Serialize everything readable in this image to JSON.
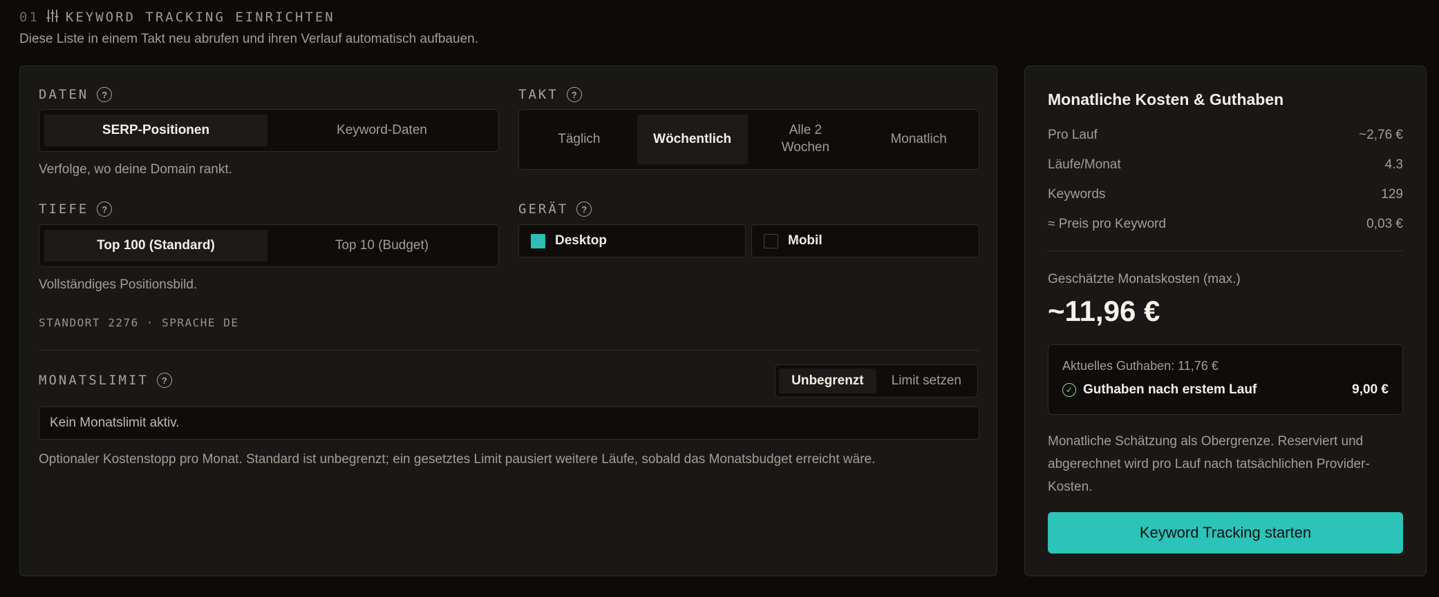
{
  "header": {
    "number": "01",
    "icon": "sliders-icon",
    "title": "KEYWORD TRACKING EINRICHTEN",
    "subtitle": "Diese Liste in einem Takt neu abrufen und ihren Verlauf automatisch aufbauen."
  },
  "daten": {
    "label": "DATEN",
    "options": [
      "SERP-Positionen",
      "Keyword-Daten"
    ],
    "selected": "SERP-Positionen",
    "help": "Verfolge, wo deine Domain rankt."
  },
  "takt": {
    "label": "TAKT",
    "options": [
      "Täglich",
      "Wöchentlich",
      "Alle 2\nWochen",
      "Monatlich"
    ],
    "selected": "Wöchentlich"
  },
  "tiefe": {
    "label": "TIEFE",
    "options": [
      "Top 100 (Standard)",
      "Top 10 (Budget)"
    ],
    "selected": "Top 100 (Standard)",
    "help": "Vollständiges Positionsbild."
  },
  "geraet": {
    "label": "GERÄT",
    "options": [
      {
        "label": "Desktop",
        "checked": true
      },
      {
        "label": "Mobil",
        "checked": false
      }
    ]
  },
  "location": "STANDORT 2276 · SPRACHE DE",
  "monatslimit": {
    "label": "MONATSLIMIT",
    "options": [
      "Unbegrenzt",
      "Limit setzen"
    ],
    "selected": "Unbegrenzt",
    "value": "Kein Monatslimit aktiv.",
    "help": "Optionaler Kostenstopp pro Monat. Standard ist unbegrenzt; ein gesetztes Limit pausiert weitere Läufe, sobald das Monatsbudget erreicht wäre."
  },
  "costs": {
    "title": "Monatliche Kosten & Guthaben",
    "rows": [
      {
        "label": "Pro Lauf",
        "value": "~2,76 €"
      },
      {
        "label": "Läufe/Monat",
        "value": "4.3"
      },
      {
        "label": "Keywords",
        "value": "129"
      },
      {
        "label": "≈ Preis pro Keyword",
        "value": "0,03 €"
      }
    ],
    "estimate_label": "Geschätzte Monatskosten (max.)",
    "estimate_value": "~11,96 €",
    "current_credit": "Aktuelles Guthaben: 11,76 €",
    "after_label": "Guthaben nach erstem Lauf",
    "after_value": "9,00 €",
    "note": "Monatliche Schätzung als Obergrenze. Reserviert und abgerechnet wird pro Lauf nach tatsächlichen Provider-Kosten.",
    "start_button": "Keyword Tracking starten"
  },
  "colors": {
    "accent": "#2cc3b8",
    "success": "#9fd37f",
    "background": "#0c0b0a",
    "panel": "#1a1816"
  }
}
